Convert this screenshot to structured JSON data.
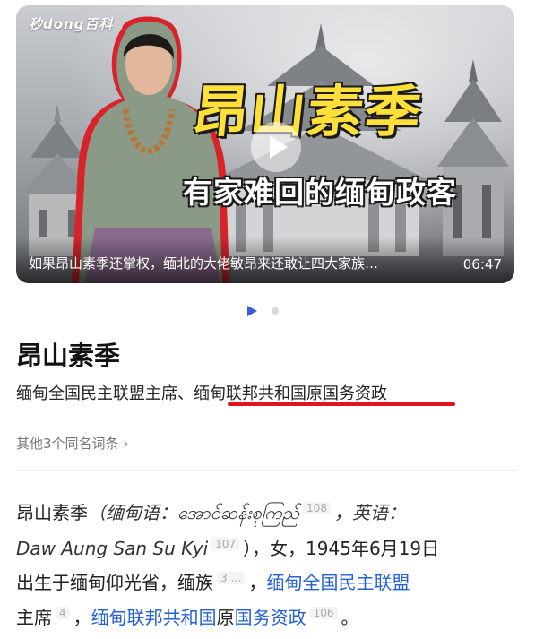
{
  "video": {
    "brand": "秒dong百科",
    "title_big": "昂山素季",
    "title_sub": "有家难回的缅甸政客",
    "caption": "如果昂山素季还掌权，缅北的大佬敏昂来还敢让四大家族…",
    "duration": "06:47"
  },
  "carousel": {
    "active_index": 1,
    "total": 2
  },
  "entry": {
    "title": "昂山素季",
    "summary_part1": "缅甸全国民主联盟主席、",
    "summary_part2": "缅甸联邦共和国原国务资政",
    "same_name_link": "其他3个同名词条",
    "chevron": "›"
  },
  "paragraph": {
    "l1_a": "昂山素季",
    "l1_paren_open": "（缅甸语：",
    "l1_burmese": "အောင်ဆန်းစုကြည်",
    "ref_108": "108",
    "l1_comma": "，英语：",
    "l2_english": "Daw Aung San Su Kyi",
    "ref_107": "107",
    "l2_rest": "），女，1945年6月19日",
    "l3_a": "出生于缅甸仰光省，缅族",
    "ref_3": "3 …",
    "l3_comma": "，",
    "l3_link": "缅甸全国民主联盟",
    "l4_a": "主席",
    "ref_4": "4",
    "l4_comma": "，",
    "l4_link1": "缅甸联邦共和国",
    "l4_mid": "原",
    "l4_link2": "国务资政",
    "ref_106": "106",
    "l4_end": "。"
  },
  "colors": {
    "link": "#2460d8",
    "accent_underline": "#e3131d",
    "title_yellow": "#ffe03a",
    "indicator": "#3a5bd9"
  }
}
